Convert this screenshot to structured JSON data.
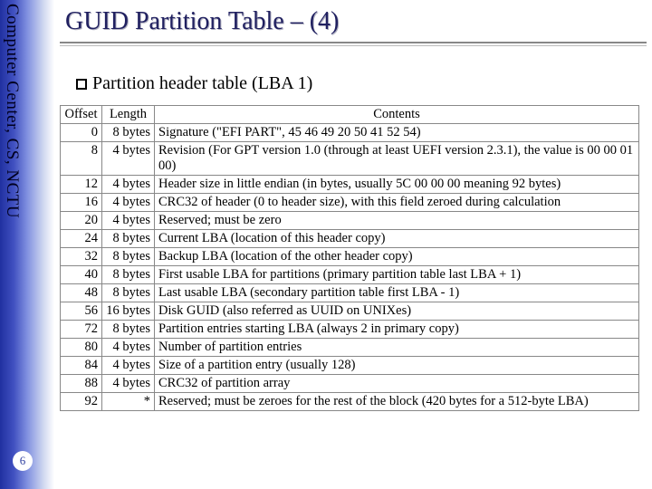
{
  "sidebar": {
    "vertical_label": "Computer Center, CS, NCTU",
    "page_number": "6"
  },
  "title": "GUID Partition Table – (4)",
  "subtitle": "Partition header table (LBA 1)",
  "table": {
    "headers": {
      "offset": "Offset",
      "length": "Length",
      "contents": "Contents"
    },
    "rows": [
      {
        "offset": "0",
        "length": "8 bytes",
        "contents": "Signature (\"EFI PART\", 45 46 49 20 50 41 52 54)"
      },
      {
        "offset": "8",
        "length": "4 bytes",
        "contents": "Revision (For GPT version 1.0 (through at least UEFI version 2.3.1), the value is 00 00 01 00)"
      },
      {
        "offset": "12",
        "length": "4 bytes",
        "contents": "Header size in little endian (in bytes, usually 5C 00 00 00 meaning 92 bytes)"
      },
      {
        "offset": "16",
        "length": "4 bytes",
        "contents": "CRC32 of header (0 to header size), with this field zeroed during calculation"
      },
      {
        "offset": "20",
        "length": "4 bytes",
        "contents": "Reserved; must be zero"
      },
      {
        "offset": "24",
        "length": "8 bytes",
        "contents": "Current LBA (location of this header copy)"
      },
      {
        "offset": "32",
        "length": "8 bytes",
        "contents": "Backup LBA (location of the other header copy)"
      },
      {
        "offset": "40",
        "length": "8 bytes",
        "contents": "First usable LBA for partitions (primary partition table last LBA + 1)"
      },
      {
        "offset": "48",
        "length": "8 bytes",
        "contents": "Last usable LBA (secondary partition table first LBA - 1)"
      },
      {
        "offset": "56",
        "length": "16 bytes",
        "contents": "Disk GUID (also referred as UUID on UNIXes)"
      },
      {
        "offset": "72",
        "length": "8 bytes",
        "contents": "Partition entries starting LBA (always 2 in primary copy)"
      },
      {
        "offset": "80",
        "length": "4 bytes",
        "contents": "Number of partition entries"
      },
      {
        "offset": "84",
        "length": "4 bytes",
        "contents": "Size of a partition entry (usually 128)"
      },
      {
        "offset": "88",
        "length": "4 bytes",
        "contents": "CRC32 of partition array"
      },
      {
        "offset": "92",
        "length": "*",
        "contents": "Reserved; must be zeroes for the rest of the block (420 bytes for a 512-byte LBA)"
      }
    ]
  }
}
